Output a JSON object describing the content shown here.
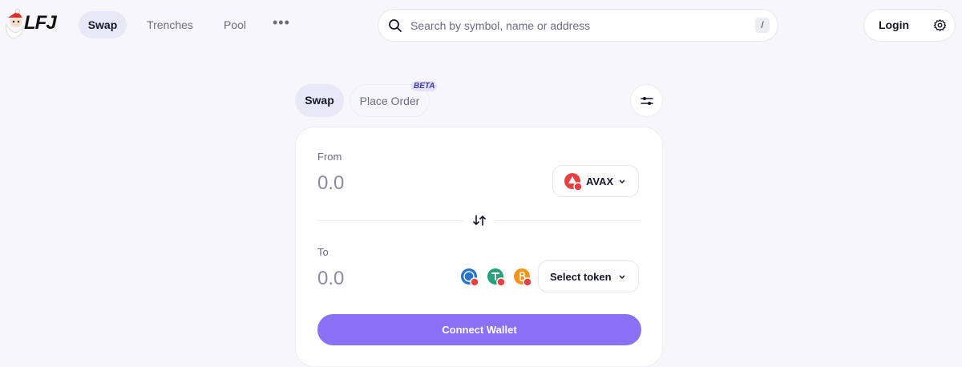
{
  "nav": {
    "logo_text": "LFJ",
    "items": [
      {
        "label": "Swap",
        "active": true
      },
      {
        "label": "Trenches",
        "active": false
      },
      {
        "label": "Pool",
        "active": false
      }
    ],
    "more_label": "•••"
  },
  "search": {
    "placeholder": "Search by symbol, name or address",
    "shortcut": "/"
  },
  "auth": {
    "login_label": "Login"
  },
  "swap_tabs": {
    "swap": "Swap",
    "place_order": "Place Order",
    "beta": "BETA"
  },
  "from": {
    "label": "From",
    "amount_placeholder": "0.0",
    "token": "AVAX"
  },
  "to": {
    "label": "To",
    "amount_placeholder": "0.0",
    "select_label": "Select token",
    "quick_tokens": [
      "usdc-icon",
      "usdt-icon",
      "btc-icon"
    ]
  },
  "connect_label": "Connect Wallet",
  "colors": {
    "accent": "#8a70f4",
    "avax": "#e84142",
    "active_tab": "#e9e8f6"
  }
}
